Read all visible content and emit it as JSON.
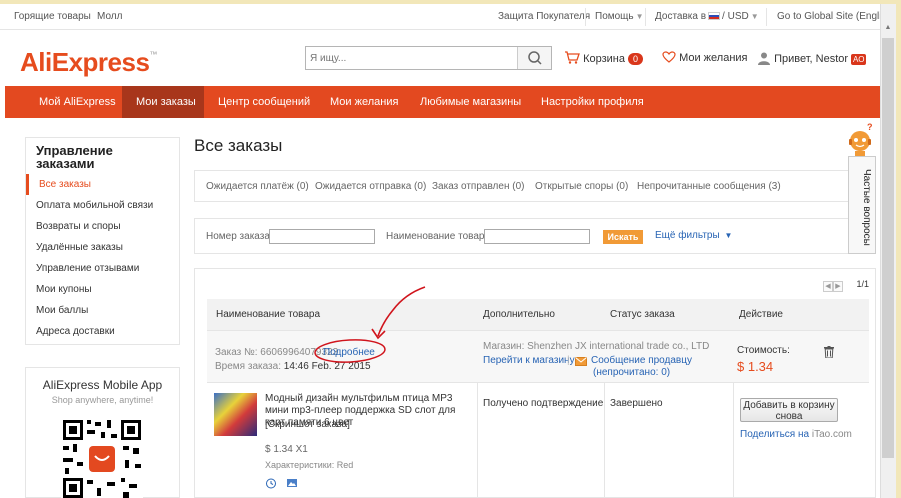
{
  "topbar": {
    "hot_products": "Горящие товары",
    "mall": "Молл",
    "buyer_protection": "Защита Покупателя",
    "help": "Помощь",
    "ship_to": "Доставка в",
    "currency": "USD",
    "global_site": "Go to Global Site (English)"
  },
  "header": {
    "logo": "AliExpress",
    "search_placeholder": "Я ищу...",
    "cart_label": "Корзина",
    "cart_count": "0",
    "wishlist_label": "Мои желания",
    "greeting": "Привет, Nestor",
    "user_badge": "АО"
  },
  "nav": [
    {
      "label": "Мой AliExpress"
    },
    {
      "label": "Мои заказы"
    },
    {
      "label": "Центр сообщений"
    },
    {
      "label": "Мои желания"
    },
    {
      "label": "Любимые магазины"
    },
    {
      "label": "Настройки профиля"
    }
  ],
  "sidebar": {
    "title": "Управление заказами",
    "items": [
      {
        "label": "Все заказы"
      },
      {
        "label": "Оплата мобильной связи"
      },
      {
        "label": "Возвраты и споры"
      },
      {
        "label": "Удалённые заказы"
      },
      {
        "label": "Управление отзывами"
      },
      {
        "label": "Мои купоны"
      },
      {
        "label": "Мои баллы"
      },
      {
        "label": "Адреса доставки"
      }
    ]
  },
  "mobile": {
    "title": "AliExpress Mobile App",
    "subtitle": "Shop anywhere, anytime!"
  },
  "main": {
    "title": "Все заказы",
    "tabs": [
      {
        "label": "Ожидается платёж (0)"
      },
      {
        "label": "Ожидается отправка (0)"
      },
      {
        "label": "Заказ отправлен (0)"
      },
      {
        "label": "Открытые споры (0)"
      },
      {
        "label": "Непрочитанные сообщения (3)"
      }
    ],
    "filters": {
      "order_number_label": "Номер заказа:",
      "product_name_label": "Наименование товара:",
      "search_button": "Искать",
      "more_filters": "Ещё фильтры"
    },
    "pager": {
      "count": "1/1"
    },
    "table_headers": {
      "product": "Наименование товара",
      "additional": "Дополнительно",
      "status": "Статус заказа",
      "action": "Действие"
    },
    "order": {
      "number_label": "Заказ №:",
      "number": "66069964079323",
      "details_link": "Подробнее",
      "time_label": "Время заказа:",
      "time": "14:46 Feb. 27 2015",
      "store_label": "Магазин:",
      "store": "Shenzhen JX international trade co., LTD",
      "go_store": "Перейти к магазину",
      "message_seller": "Сообщение продавцу",
      "unread": "(непрочитано: 0)",
      "cost_label": "Стоимость:",
      "cost": "$ 1.34",
      "product_name": "Модный дизайн мультфильм птица MP3 мини mp3-плеер поддержка SD слот для карт памяти 6 цвет",
      "snapshot": "[Скриншот заказа]",
      "price_qty": "$ 1.34 X1",
      "characteristics": "Характеристики: Red",
      "additional_status": "Получено подтверждение",
      "order_status": "Завершено",
      "add_to_cart": "Добавить в корзину снова",
      "share_prefix": "Поделиться на",
      "share_site": "iTao.com"
    }
  },
  "faq": {
    "label": "Частые вопросы"
  },
  "colors": {
    "brand_orange": "#e34920",
    "active_nav": "#a8361b",
    "link_blue": "#2864b4",
    "price_red": "#e64c1e",
    "search_button": "#f19a36",
    "annotation_red": "#d0141c"
  }
}
